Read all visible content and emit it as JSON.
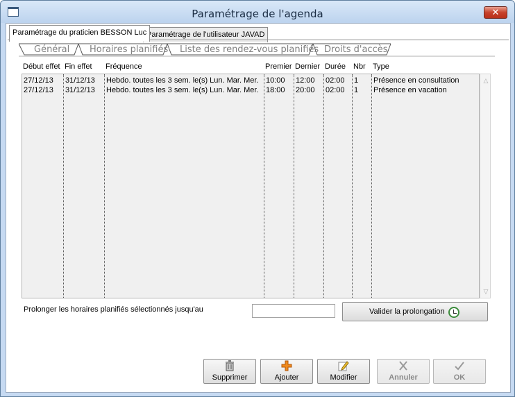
{
  "window": {
    "title": "Paramétrage de l'agenda",
    "close_glyph": "✕"
  },
  "outer_tabs": [
    {
      "label": "Paramétrage du praticien BESSON Luc",
      "active": true
    },
    {
      "label": "Paramétrage de l'utilisateur JAVAD",
      "active": false
    }
  ],
  "inner_tabs": [
    {
      "label": "Général"
    },
    {
      "label": "Horaires planifiés"
    },
    {
      "label": "Liste des rendez-vous planifiés"
    },
    {
      "label": "Droits d'accès"
    }
  ],
  "grid": {
    "columns": [
      "Début effet",
      "Fin effet",
      "Fréquence",
      "Premier",
      "Dernier",
      "Durée",
      "Nbr",
      "Type"
    ],
    "rows": [
      [
        "27/12/13",
        "31/12/13",
        "Hebdo. toutes les 3 sem. le(s) Lun. Mar. Mer.",
        "10:00",
        "12:00",
        "02:00",
        "1",
        "Présence en consultation"
      ],
      [
        "27/12/13",
        "31/12/13",
        "Hebdo. toutes les 3 sem. le(s) Lun. Mar. Mer.",
        "18:00",
        "20:00",
        "02:00",
        "1",
        "Présence en vacation"
      ]
    ]
  },
  "prolong": {
    "label": "Prolonger les horaires planifiés sélectionnés jusqu'au",
    "value": "",
    "button_label": "Valider la prolongation"
  },
  "actions": {
    "delete": "Supprimer",
    "add": "Ajouter",
    "edit": "Modifier",
    "cancel": "Annuler",
    "ok": "OK"
  }
}
